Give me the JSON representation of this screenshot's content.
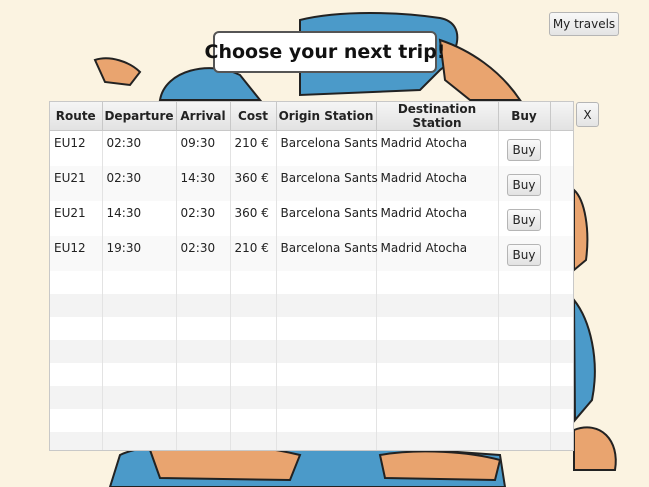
{
  "header": {
    "my_travels_label": "My travels",
    "title": "Choose your next trip!",
    "close_label": "X"
  },
  "table": {
    "columns": [
      "Route",
      "Departure",
      "Arrival",
      "Cost",
      "Origin Station",
      "Destination Station",
      "Buy"
    ],
    "rows": [
      {
        "route": "EU12",
        "departure": "02:30",
        "arrival": "09:30",
        "cost": "210 €",
        "origin": "Barcelona Sants",
        "destination": "Madrid Atocha",
        "buy_label": "Buy"
      },
      {
        "route": "EU21",
        "departure": "02:30",
        "arrival": "14:30",
        "cost": "360 €",
        "origin": "Barcelona Sants",
        "destination": "Madrid Atocha",
        "buy_label": "Buy"
      },
      {
        "route": "EU21",
        "departure": "14:30",
        "arrival": "02:30",
        "cost": "360 €",
        "origin": "Barcelona Sants",
        "destination": "Madrid Atocha",
        "buy_label": "Buy"
      },
      {
        "route": "EU12",
        "departure": "19:30",
        "arrival": "02:30",
        "cost": "210 €",
        "origin": "Barcelona Sants",
        "destination": "Madrid Atocha",
        "buy_label": "Buy"
      }
    ]
  },
  "colors": {
    "background": "#fbf3e1",
    "sea": "#4b9ac9",
    "land": "#e9a46f"
  }
}
